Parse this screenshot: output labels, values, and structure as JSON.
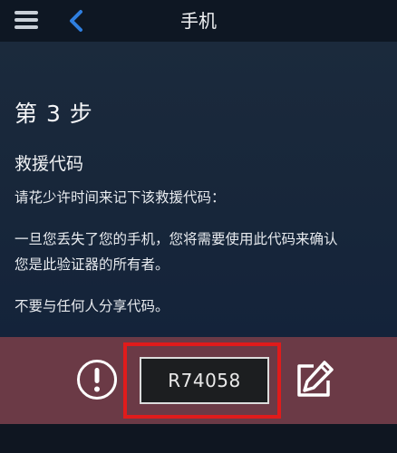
{
  "header": {
    "title": "手机",
    "menu_icon": "hamburger-menu-icon",
    "back_icon": "chevron-left-icon"
  },
  "content": {
    "step": "第 3 步",
    "section_title": "救援代码",
    "instruction": "请花少许时间来记下该救援代码：",
    "explanation_line1": "一旦您丢失了您的手机，您将需要使用此代码来确认",
    "explanation_line2": "您是此验证器的所有者。",
    "warning_text": "不要与任何人分享代码。"
  },
  "code_section": {
    "code": "R74058",
    "warning_icon": "exclamation-circle-icon",
    "edit_icon": "edit-pencil-icon"
  },
  "colors": {
    "header_bg": "#0e1723",
    "content_bg": "#1b2a3c",
    "code_strip_bg": "#6b3a46",
    "highlight": "#e01b1b",
    "back_accent": "#2f7fe0"
  }
}
